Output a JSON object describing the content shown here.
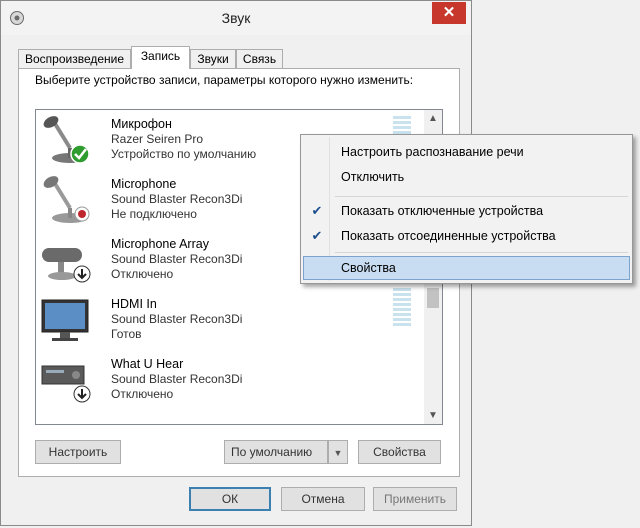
{
  "window": {
    "title": "Звук",
    "close_glyph": "✕"
  },
  "tabs": [
    {
      "label": "Воспроизведение"
    },
    {
      "label": "Запись"
    },
    {
      "label": "Звуки"
    },
    {
      "label": "Связь"
    }
  ],
  "prompt": "Выберите устройство записи, параметры которого нужно изменить:",
  "devices": [
    {
      "name": "Микрофон",
      "line2": "Razer Seiren Pro",
      "line3": "Устройство по умолчанию",
      "icon": "microphone-default-icon"
    },
    {
      "name": "Microphone",
      "line2": "Sound Blaster Recon3Di",
      "line3": "Не подключено",
      "icon": "microphone-unplugged-icon"
    },
    {
      "name": "Microphone Array",
      "line2": "Sound Blaster Recon3Di",
      "line3": "Отключено",
      "icon": "microphone-array-disabled-icon"
    },
    {
      "name": "HDMI In",
      "line2": "Sound Blaster Recon3Di",
      "line3": "Готов",
      "icon": "monitor-icon"
    },
    {
      "name": "What U Hear",
      "line2": "Sound Blaster Recon3Di",
      "line3": "Отключено",
      "icon": "audio-device-disabled-icon"
    }
  ],
  "buttons": {
    "configure": "Настроить",
    "set_default": "По умолчанию",
    "properties": "Свойства",
    "ok": "ОК",
    "cancel": "Отмена",
    "apply": "Применить"
  },
  "context_menu": {
    "items": [
      {
        "label": "Настроить распознавание речи",
        "checked": false
      },
      {
        "label": "Отключить",
        "checked": false
      },
      {
        "label": "Показать отключенные устройства",
        "checked": true
      },
      {
        "label": "Показать отсоединенные устройства",
        "checked": true
      },
      {
        "label": "Свойства",
        "checked": false,
        "highlighted": true
      }
    ],
    "check_glyph": "✔"
  },
  "colors": {
    "close_button": "#c7372c",
    "menu_highlight": "#c8ddf1",
    "default_badge": "#2e9c2e"
  }
}
